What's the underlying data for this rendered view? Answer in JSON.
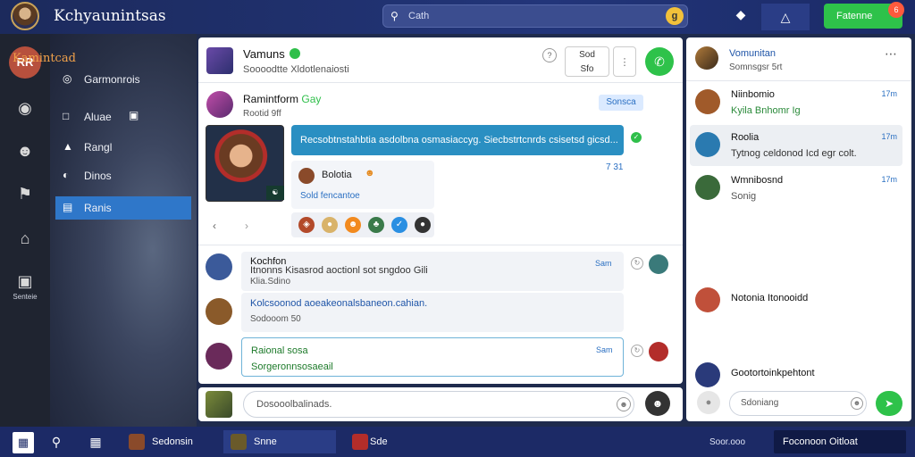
{
  "app": {
    "title": "Kchyaunintsas"
  },
  "search": {
    "placeholder": "Cath",
    "button": "g"
  },
  "top_action": {
    "label": "Fatenne",
    "badge": "6"
  },
  "rail": {
    "avatar_label": "RR",
    "bottom_label": "Senteie"
  },
  "nav": {
    "header": "Kamintcad",
    "items": [
      {
        "label": "Garmonrois",
        "icon": "gamepad-icon"
      },
      {
        "label": "Aluae",
        "icon": "square-icon"
      },
      {
        "label": "Rangl",
        "icon": "rank-icon"
      },
      {
        "label": "Dinos",
        "icon": "dino-icon"
      },
      {
        "label": "Ranis",
        "icon": "list-icon"
      }
    ]
  },
  "chat": {
    "title": "Vamuns",
    "status_icon": "online-icon",
    "subtitle": "Soooodtte Xldotlenaiosti",
    "head_buttons": [
      "Sod",
      "Sfo"
    ],
    "message_1": {
      "name": "Ramintform",
      "name_tag": "Gay",
      "sub": "Rootid 9ff",
      "pill": "Sonsca",
      "bubble": "Recsobtnstahbtia asdolbna osmasiaccyg. Siecbstrtcnrds csisetsd gicsd...",
      "time": "7 31",
      "reply_name": "Bolotia",
      "reply_sub": "Sold fencantoe",
      "reactions": [
        "fire",
        "bee",
        "smile",
        "leaf",
        "check",
        "ghost"
      ]
    },
    "messages": [
      {
        "name": "Kochfon",
        "body": "Itnonns Kisasrod aoctionl sot sngdoo Gili",
        "sub": "Klia.Sdino",
        "time": "Sam",
        "avatar": "#3b5a9a"
      },
      {
        "name": "",
        "body": "Kolcsoonod aoeakeonalsbaneon.cahian.",
        "sub": "Sodooom 50",
        "time": "",
        "avatar": "#8a5a2a"
      },
      {
        "name": "Raional sosa",
        "body": "Sorgeronnsosaeail",
        "sub": "",
        "time": "Sam",
        "avatar": "#6a2a5a"
      }
    ],
    "composer_placeholder": "Dosooolbalinads."
  },
  "right": {
    "title": "Vomunitan",
    "subtitle": "Somnsgsr 5rt",
    "conversations": [
      {
        "name": "Niinbomio",
        "msg": "Kyila Bnhomr Ig",
        "time": "17m",
        "avatar": "#a05a2a"
      },
      {
        "name": "Roolia",
        "msg": "Tytnog celdonod Icd egr colt.",
        "time": "17m",
        "avatar": "#2a7ab0"
      },
      {
        "name": "Wmnibosnd",
        "msg": "Sonig",
        "time": "17m",
        "avatar": "#3a6a3a"
      },
      {
        "name": "Notonia Itonooidd",
        "msg": "",
        "time": "",
        "avatar": "#c0503a"
      },
      {
        "name": "Gootortoinkpehtont",
        "msg": "",
        "time": "",
        "avatar": "#2a3a7a"
      }
    ],
    "composer_placeholder": "Sdoniang"
  },
  "taskbar": {
    "tasks": [
      "Sedonsin",
      "Snne",
      "Sde"
    ],
    "sys": "Soor.ooo",
    "clock": "Foconoon Oitloat"
  }
}
